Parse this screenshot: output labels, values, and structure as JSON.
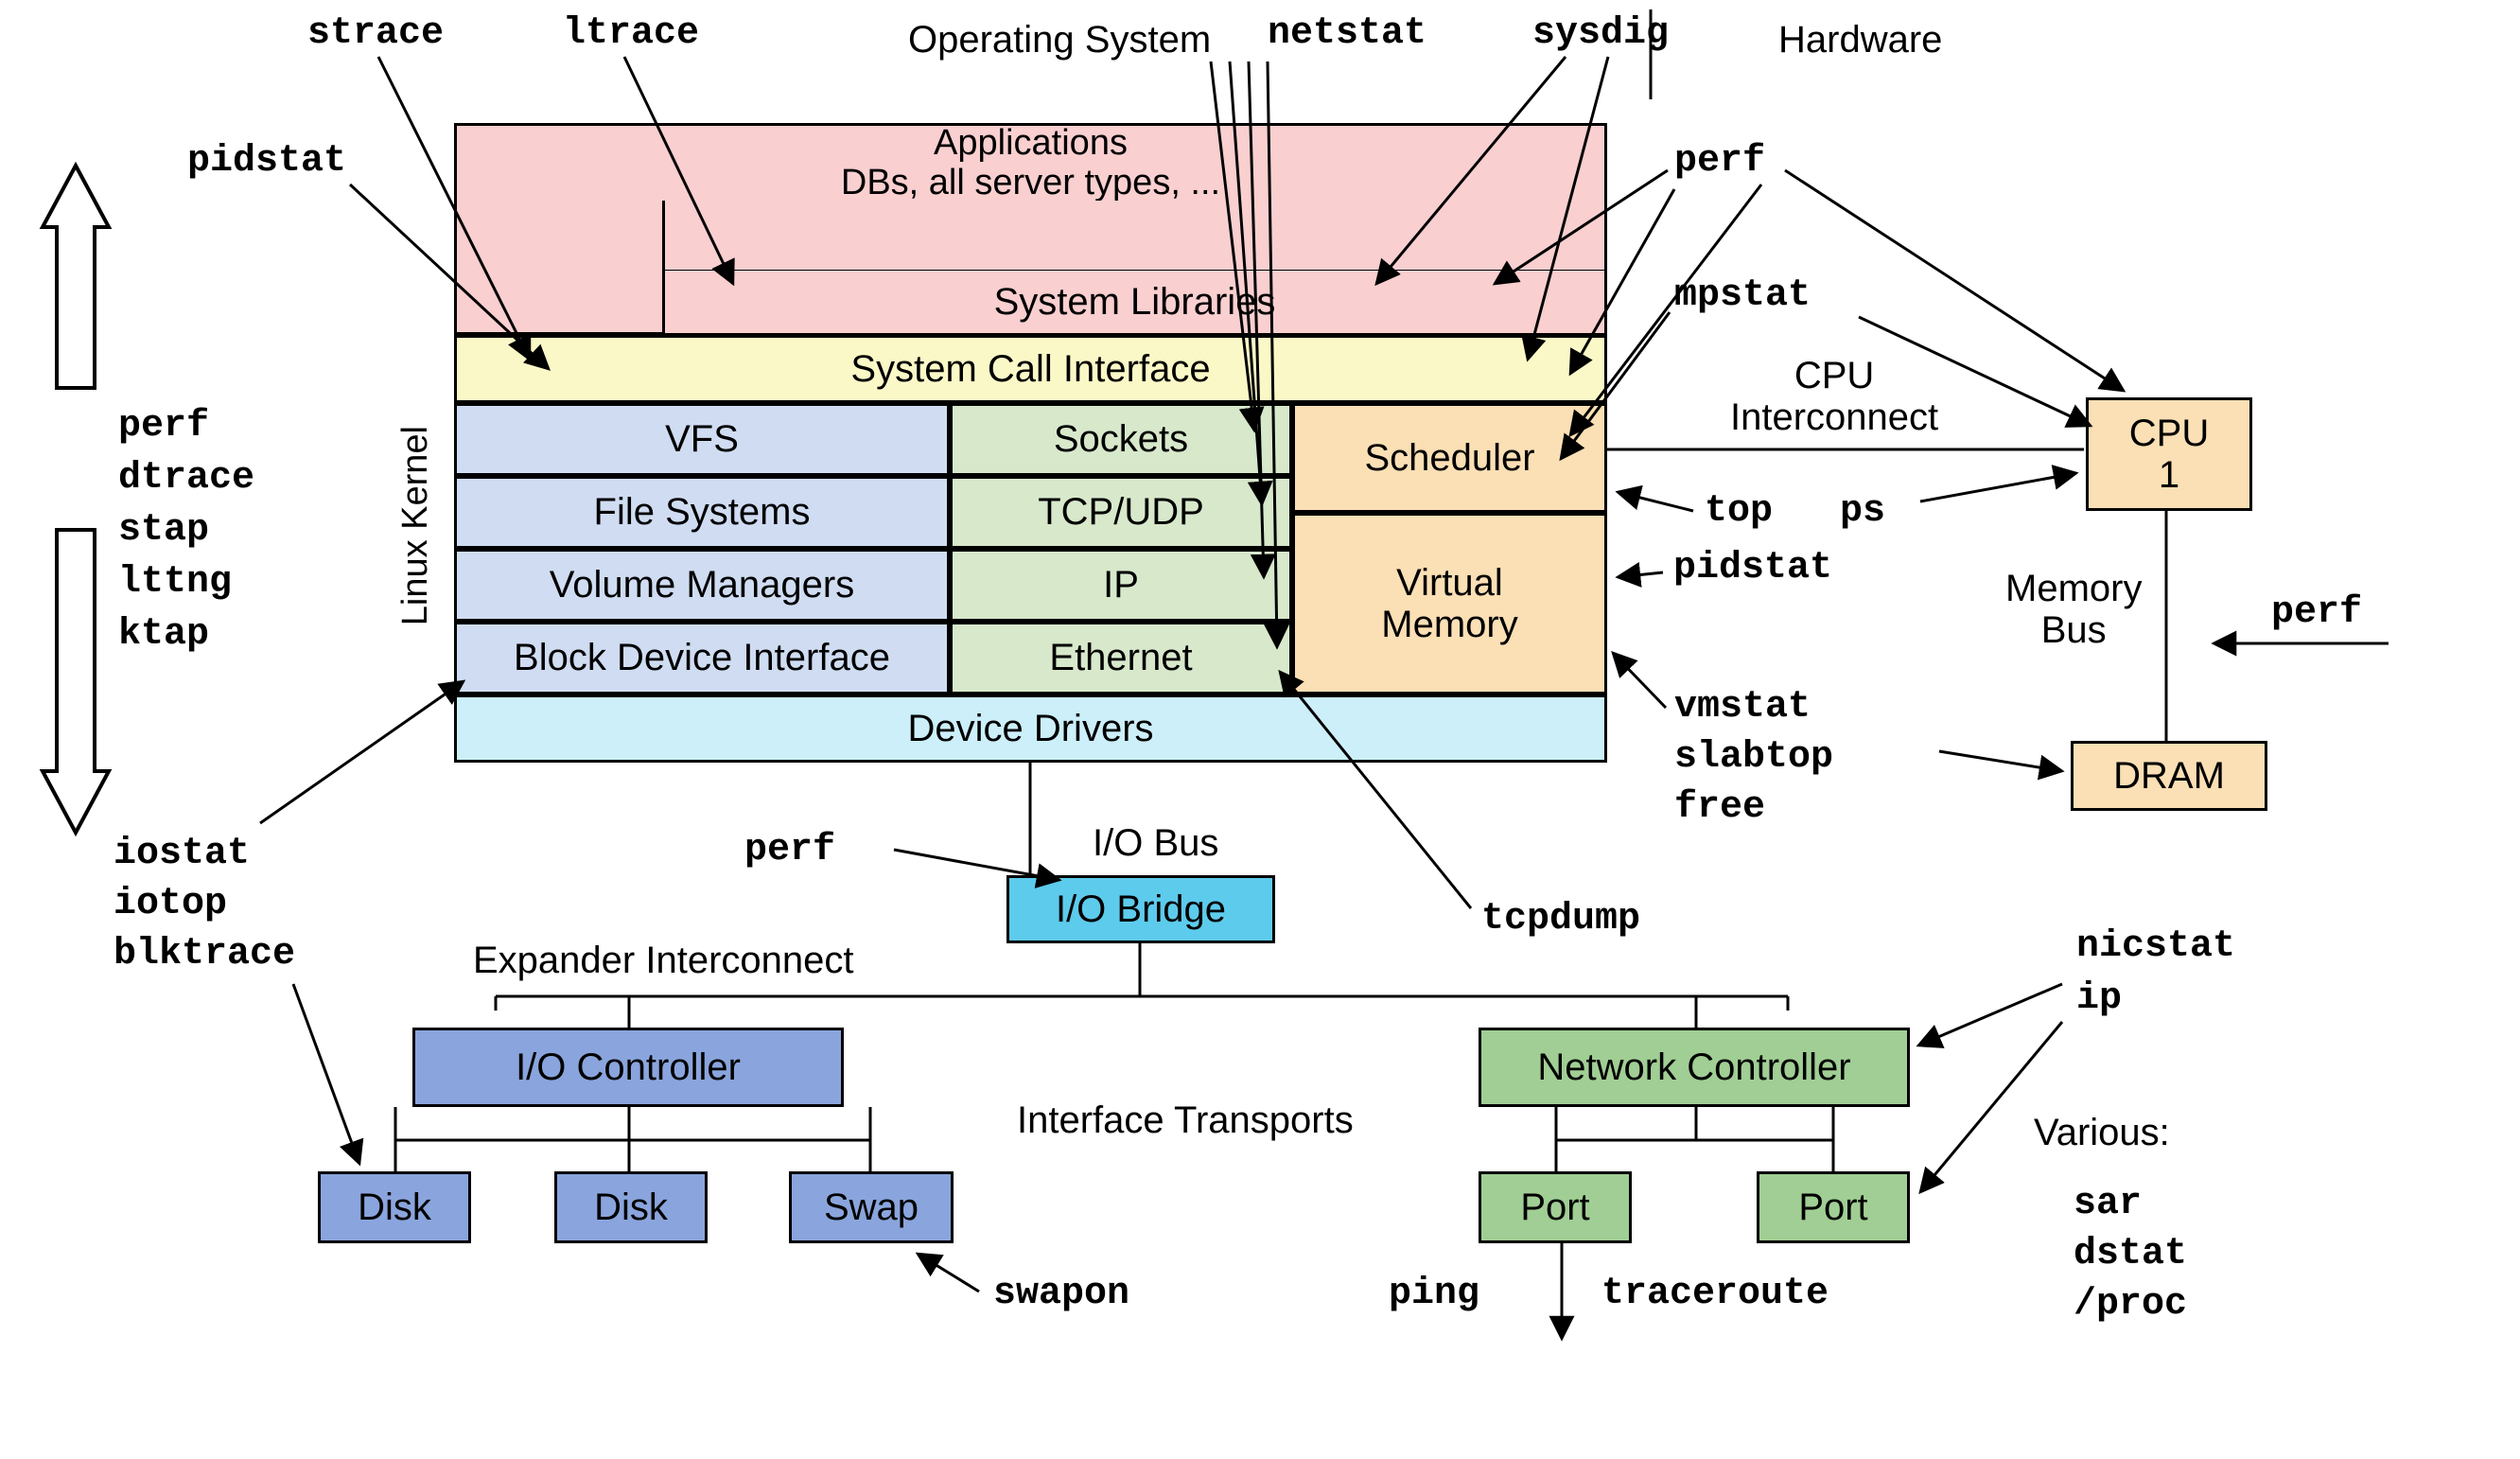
{
  "headers": {
    "operating_system": "Operating System",
    "hardware": "Hardware"
  },
  "tools": {
    "strace": "strace",
    "ltrace": "ltrace",
    "pidstat": "pidstat",
    "netstat": "netstat",
    "sysdig": "sysdig",
    "perf": "perf",
    "mpstat": "mpstat",
    "top": "top",
    "ps": "ps",
    "pidstat2": "pidstat",
    "perf_mem": "perf",
    "vmstat": "vmstat",
    "slabtop": "slabtop",
    "free": "free",
    "tcpdump": "tcpdump",
    "iostat": "iostat",
    "iotop": "iotop",
    "blktrace": "blktrace",
    "perf_io": "perf",
    "swapon": "swapon",
    "ping": "ping",
    "traceroute": "traceroute",
    "nicstat": "nicstat",
    "ip": "ip",
    "various": "Various:",
    "sar": "sar",
    "dstat": "dstat",
    "proc": "/proc",
    "stack_perf": "perf",
    "stack_dtrace": "dtrace",
    "stack_stap": "stap",
    "stack_lttng": "lttng",
    "stack_ktap": "ktap"
  },
  "boxes": {
    "applications": "Applications",
    "dbs": "DBs, all server types, ...",
    "system_libraries": "System Libraries",
    "system_call_interface": "System Call Interface",
    "vfs": "VFS",
    "file_systems": "File Systems",
    "volume_managers": "Volume Managers",
    "block_device_interface": "Block Device Interface",
    "sockets": "Sockets",
    "tcp_udp": "TCP/UDP",
    "ip": "IP",
    "ethernet": "Ethernet",
    "scheduler": "Scheduler",
    "virtual_memory": "Virtual\nMemory",
    "device_drivers": "Device Drivers",
    "linux_kernel": "Linux Kernel",
    "cpu_interconnect": "CPU\nInterconnect",
    "cpu1": "CPU\n1",
    "memory_bus": "Memory\nBus",
    "dram": "DRAM",
    "io_bus": "I/O Bus",
    "io_bridge": "I/O Bridge",
    "expander_interconnect": "Expander Interconnect",
    "interface_transports": "Interface Transports",
    "io_controller": "I/O Controller",
    "network_controller": "Network Controller",
    "disk": "Disk",
    "swap": "Swap",
    "port": "Port"
  }
}
